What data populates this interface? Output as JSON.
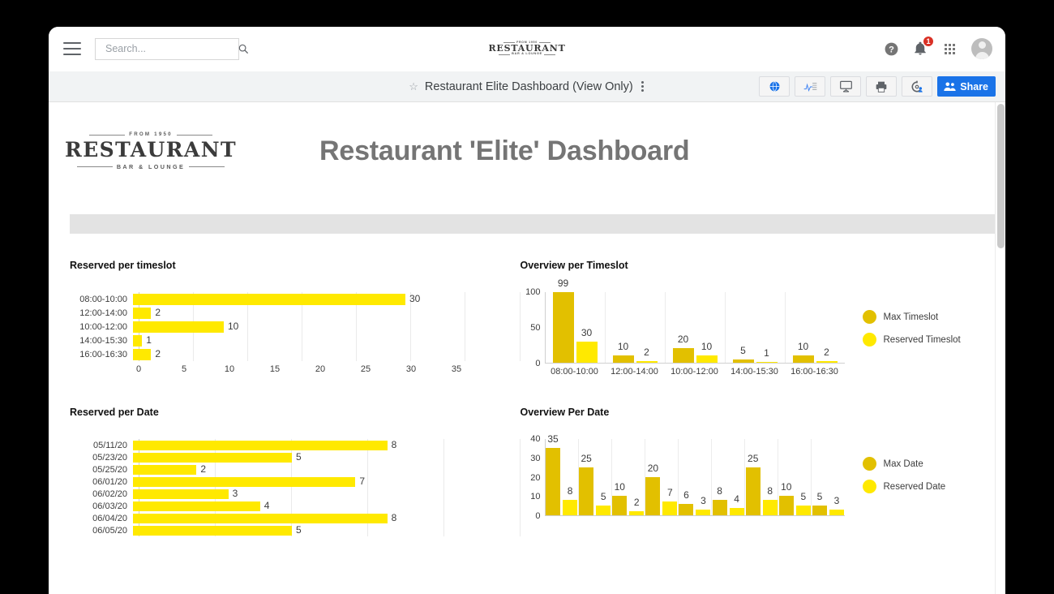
{
  "appbar": {
    "menu_icon": "hamburger-icon",
    "search": {
      "value": "",
      "placeholder": "Search..."
    },
    "search_icon": "search-icon",
    "brand": {
      "top": "FROM 1950",
      "main": "RESTAURANT",
      "bottom": "BAR & LOUNGE"
    },
    "help_icon": "help-icon",
    "notifications_icon": "bell-icon",
    "notifications_count": "1",
    "apps_icon": "apps-grid-icon",
    "avatar_icon": "account-avatar"
  },
  "titlebar": {
    "star_icon": "star-outline-icon",
    "title": "Restaurant Elite Dashboard (View Only)",
    "kebab_icon": "more-options-icon",
    "actions": [
      {
        "name": "publish-button",
        "icon": "globe-icon"
      },
      {
        "name": "explore-button",
        "icon": "analytics-icon"
      },
      {
        "name": "present-button",
        "icon": "presentation-icon"
      },
      {
        "name": "print-button",
        "icon": "printer-icon"
      },
      {
        "name": "settings-button",
        "icon": "gear-person-icon"
      }
    ],
    "share_label": "Share",
    "share_icon": "people-icon",
    "share_color": "#1a73e8"
  },
  "dashboard": {
    "logo": {
      "top": "FROM 1950",
      "main": "RESTAURANT",
      "bottom": "BAR & LOUNGE"
    },
    "title": "Restaurant 'Elite' Dashboard",
    "title_color": "#757575",
    "band_color": "#e3e3e3"
  },
  "colors": {
    "reserved": "#ffe900",
    "max": "#e2c000",
    "axis_text": "#3c3c3c"
  },
  "chart_data": [
    {
      "id": "reserved-per-timeslot",
      "type": "bar",
      "orientation": "horizontal",
      "title": "Reserved per timeslot",
      "categories": [
        "08:00-10:00",
        "12:00-14:00",
        "10:00-12:00",
        "14:00-15:30",
        "16:00-16:30"
      ],
      "values": [
        30,
        2,
        10,
        1,
        2
      ],
      "series": [
        {
          "name": "Reserved Timeslot",
          "values": [
            30,
            2,
            10,
            1,
            2
          ],
          "color": "#ffe900"
        }
      ],
      "xlabel": "",
      "ylabel": "",
      "xlim": [
        0,
        35
      ],
      "xticks": [
        0,
        5,
        10,
        15,
        20,
        25,
        30,
        35
      ],
      "grid": true,
      "legend": "none"
    },
    {
      "id": "overview-per-timeslot",
      "type": "bar",
      "orientation": "vertical",
      "title": "Overview per Timeslot",
      "categories": [
        "08:00-10:00",
        "12:00-14:00",
        "10:00-12:00",
        "14:00-15:30",
        "16:00-16:30"
      ],
      "series": [
        {
          "name": "Max Timeslot",
          "values": [
            99,
            10,
            20,
            5,
            10
          ],
          "color": "#e2c000"
        },
        {
          "name": "Reserved Timeslot",
          "values": [
            30,
            2,
            10,
            1,
            2
          ],
          "color": "#ffe900"
        }
      ],
      "xlabel": "",
      "ylabel": "",
      "ylim": [
        0,
        100
      ],
      "yticks": [
        0,
        50,
        100
      ],
      "grid": true,
      "legend": "right"
    },
    {
      "id": "reserved-per-date",
      "type": "bar",
      "orientation": "horizontal",
      "title": "Reserved per Date",
      "categories": [
        "05/11/20",
        "05/23/20",
        "05/25/20",
        "06/01/20",
        "06/02/20",
        "06/03/20",
        "06/04/20",
        "06/05/20"
      ],
      "values": [
        8,
        5,
        2,
        7,
        3,
        4,
        8,
        5
      ],
      "series": [
        {
          "name": "Reserved Date",
          "values": [
            8,
            5,
            2,
            7,
            3,
            4,
            8,
            5
          ],
          "color": "#ffe900"
        }
      ],
      "xlabel": "",
      "ylabel": "",
      "xlim": [
        0,
        10
      ],
      "xticks": [
        0,
        2,
        4,
        6,
        8,
        10
      ],
      "grid": true,
      "legend": "none",
      "clipped": true
    },
    {
      "id": "overview-per-date",
      "type": "bar",
      "orientation": "vertical",
      "title": "Overview Per Date",
      "categories": [
        "",
        "",
        "",
        "",
        "",
        "",
        "",
        "",
        ""
      ],
      "series": [
        {
          "name": "Max Date",
          "values": [
            35,
            25,
            10,
            20,
            6,
            8,
            25,
            10,
            5
          ],
          "color": "#e2c000"
        },
        {
          "name": "Reserved Date",
          "values": [
            8,
            5,
            2,
            7,
            3,
            4,
            8,
            5,
            3
          ],
          "color": "#ffe900"
        }
      ],
      "xlabel": "",
      "ylabel": "",
      "ylim": [
        0,
        40
      ],
      "yticks": [
        0,
        10,
        20,
        30,
        40
      ],
      "grid": true,
      "legend": "right",
      "clipped": true
    }
  ]
}
